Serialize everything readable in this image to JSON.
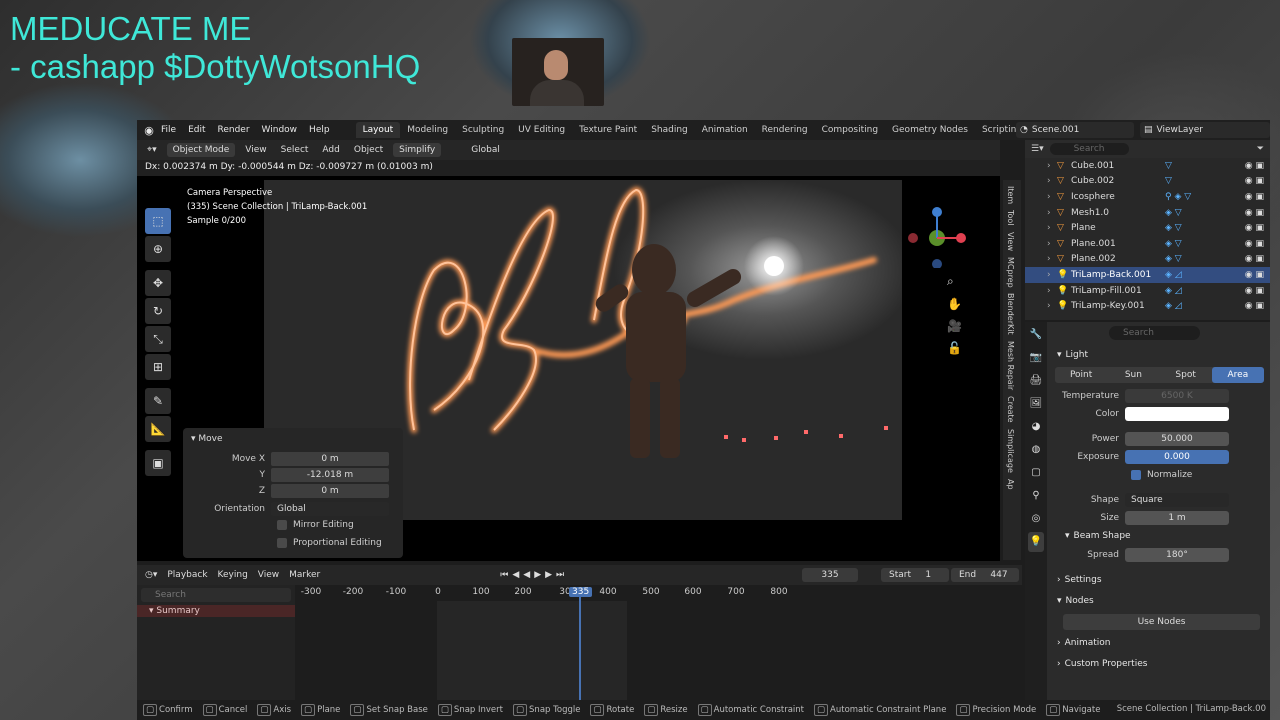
{
  "overlay": {
    "line1": "MEDUCATE ME",
    "line2": "- cashapp $DottyWotsonHQ"
  },
  "menu": [
    "File",
    "Edit",
    "Render",
    "Window",
    "Help"
  ],
  "workspaces": [
    "Layout",
    "Modeling",
    "Sculpting",
    "UV Editing",
    "Texture Paint",
    "Shading",
    "Animation",
    "Rendering",
    "Compositing",
    "Geometry Nodes",
    "Scripting"
  ],
  "scene": "Scene.001",
  "view_layer": "ViewLayer",
  "vp_header": {
    "mode": "Object Mode",
    "view": "View",
    "select": "Select",
    "add": "Add",
    "object": "Object",
    "simplify": "Simplify",
    "orientation": "Global"
  },
  "status_msg": "Dx: 0.002374 m  Dy: -0.000544 m  Dz: -0.009727 m (0.01003 m)",
  "camera": {
    "line1": "Camera Perspective",
    "line2": "(335) Scene Collection | TriLamp-Back.001",
    "line3": "Sample 0/200"
  },
  "move": {
    "title": "Move",
    "x_label": "Move X",
    "x": "0 m",
    "y_label": "Y",
    "y": "-12.018 m",
    "z_label": "Z",
    "z": "0 m",
    "orient_label": "Orientation",
    "orient": "Global",
    "mirror": "Mirror Editing",
    "proportional": "Proportional Editing"
  },
  "side_tabs": [
    "Item",
    "Tool",
    "View",
    "MCprep",
    "BlenderKit",
    "Mesh Repair",
    "Create",
    "Simplicage",
    "Ap"
  ],
  "timeline": {
    "playback": "Playback",
    "keying": "Keying",
    "view": "View",
    "marker": "Marker",
    "current": "335",
    "start_label": "Start",
    "start": "1",
    "end_label": "End",
    "end": "447",
    "search": "Search",
    "summary": "Summary",
    "ticks": [
      "-300",
      "-200",
      "-100",
      "0",
      "100",
      "200",
      "30",
      "400",
      "500",
      "600",
      "700",
      "800"
    ],
    "playhead": "335"
  },
  "outliner": {
    "search": "Search",
    "items": [
      {
        "name": "Cube.001",
        "mods": "▽"
      },
      {
        "name": "Cube.002",
        "mods": "▽"
      },
      {
        "name": "Icosphere",
        "mods": "⚲ ◈ ▽"
      },
      {
        "name": "Mesh1.0",
        "mods": "◈ ▽"
      },
      {
        "name": "Plane",
        "mods": "◈ ▽"
      },
      {
        "name": "Plane.001",
        "mods": "◈ ▽"
      },
      {
        "name": "Plane.002",
        "mods": "◈ ▽"
      },
      {
        "name": "TriLamp-Back.001",
        "mods": "◈ ◿"
      },
      {
        "name": "TriLamp-Fill.001",
        "mods": "◈ ◿"
      },
      {
        "name": "TriLamp-Key.001",
        "mods": "◈ ◿"
      }
    ]
  },
  "props": {
    "search": "Search",
    "light": "Light",
    "types": [
      "Point",
      "Sun",
      "Spot",
      "Area"
    ],
    "temperature_label": "Temperature",
    "temperature": "6500 K",
    "color_label": "Color",
    "power_label": "Power",
    "power": "50.000",
    "exposure_label": "Exposure",
    "exposure": "0.000",
    "normalize": "Normalize",
    "shape_label": "Shape",
    "shape": "Square",
    "size_label": "Size",
    "size": "1 m",
    "beam_shape": "Beam Shape",
    "spread_label": "Spread",
    "spread": "180°",
    "settings": "Settings",
    "nodes": "Nodes",
    "use_nodes": "Use Nodes",
    "animation": "Animation",
    "custom": "Custom Properties"
  },
  "statusbar": {
    "items": [
      "Confirm",
      "Cancel",
      "Axis",
      "Plane",
      "Set Snap Base",
      "Snap Invert",
      "Snap Toggle",
      "Rotate",
      "Resize",
      "Automatic Constraint",
      "Automatic Constraint Plane",
      "Precision Mode",
      "Navigate"
    ],
    "right": "Scene Collection | TriLamp-Back.00"
  },
  "colors": {
    "accent": "#4772b3",
    "overlay_text": "#3fe8d8",
    "neon": "#ff9a55"
  }
}
